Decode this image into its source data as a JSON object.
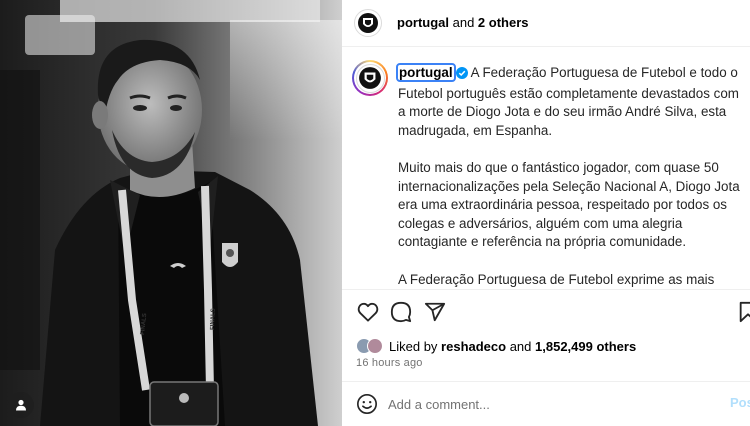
{
  "header": {
    "author": "portugal",
    "and_text": " and ",
    "others": "2 others"
  },
  "caption": {
    "username": "portugal",
    "paragraphs": [
      "A Federação Portuguesa de Futebol e todo o Futebol português estão completamente devastados com a morte de Diogo Jota e do seu irmão André Silva, esta madrugada, em Espanha.",
      "Muito mais do que o fantástico jogador, com quase 50 internacionalizações pela Seleção Nacional A, Diogo Jota era uma extraordinária pessoa, respeitado por todos os colegas e adversários, alguém com uma alegria contagiante e referência na própria comunidade.",
      "A Federação Portuguesa de Futebol exprime as mais sentidas condolências à família e aos amigos de Diogo e de André Silva, assim como ao Liverpool FC e FC Penafiel, os clubes onde, respetivamente, alinhavam os jogadores."
    ]
  },
  "actions": {
    "like_icon": "heart-icon",
    "comment_icon": "comment-icon",
    "share_icon": "send-icon",
    "save_icon": "bookmark-icon"
  },
  "likes": {
    "prefix": "Liked by ",
    "user": "reshadeco",
    "middle": " and ",
    "count": "1,852,499 others"
  },
  "timestamp": "16 hours ago",
  "comment": {
    "placeholder": "Add a comment...",
    "post_label": "Post"
  },
  "photo": {
    "lanyard_text": "FINALS",
    "user_tag_icon": "person-icon"
  },
  "colors": {
    "verified": "#0095f6",
    "selection_outline": "#3b82f6",
    "post_disabled": "#b2dffc"
  }
}
